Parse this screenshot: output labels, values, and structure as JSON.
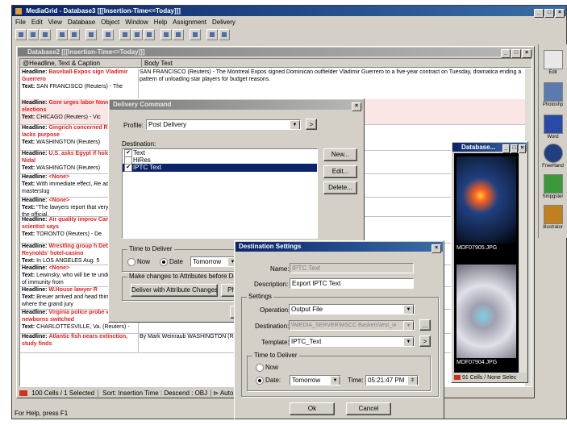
{
  "app": {
    "title": "MediaGrid - Database3 [[[Insertion-Time<=Today]]]",
    "menu": [
      "File",
      "Edit",
      "View",
      "Database",
      "Object",
      "Window",
      "Help",
      "Assignment",
      "Delivery"
    ],
    "status": "For Help, press F1"
  },
  "dock": {
    "items": [
      "Edit",
      "Photoshp",
      "Word",
      "FreeHand",
      "Smpgster",
      "Illustrator"
    ]
  },
  "db": {
    "title": "Database2 [[[Insertion-Time<=Today]]]",
    "col1": "@Headline, Text & Caption",
    "col2": "Body Text",
    "rows": [
      {
        "h": "Baseball-Expos sign Vladimir Guerrero",
        "t": "SAN FRANCISCO (Reuters) - The",
        "body": "SAN FRANCISCO (Reuters) - The Montreal Expos signed Dominican outfielder Vladimir Guerrero to a five-year contract on Tuesday, dramatica ending a pattern of unloading star players for budget reasons."
      },
      {
        "h": "Gore urges labor November elections",
        "t": "CHICAGO (Reuters) - Vic",
        "body": "S."
      },
      {
        "h": "Gingrich concerned Russia trip lacks purpose",
        "t": "WASHINGTON (Reuters)",
        "body": "ent Clinton's coming trip to Russia lacks a clear purpose and rday."
      },
      {
        "h": "U.S. asks Egypt if holding Abu Nidal",
        "t": "WASHINGTON (Reuters)",
        "body": ""
      },
      {
        "h": "<None>",
        "t": "With immediate effect, Re adopting the masterslug",
        "body": "ories about the U.S."
      },
      {
        "h": "<None>",
        "t": "\"The lawyers report that very well,\" said the official.",
        "body": ""
      },
      {
        "h": "Air quality improv Canada, scientist says",
        "t": "TORONTO (Reuters) - De",
        "body": "thern Ontario and Quebec, air q gency said Thursday."
      },
      {
        "h": "Wrestling group h Debbie Reynolds' hotel-casino",
        "t": "In LOS ANGELES Aug. 5",
        "body": ""
      },
      {
        "h": "<None>",
        "t": "Lewinsky, who will be te under a grant of immunity from",
        "body": ""
      },
      {
        "h": "W.House lawyer R",
        "t": "Breuer arrived and head third floor area where the grand jury",
        "body": ""
      },
      {
        "h": "Virginia police probe whether newborns switched",
        "t": "CHARLOTTESVILLE, Va. (Reuters) -",
        "body": "CHARLOTTESVILLE, Va."
      },
      {
        "h": "Atlantic fish nears extinction, study finds",
        "t": "",
        "body": "By Mark Weinraub WASHINGTON (Reuters) - A fish"
      }
    ],
    "headline_label": "Headline:",
    "text_label": "Text:",
    "status": {
      "cells": "100 Cells / 1 Selected",
      "sort": "Sort: Insertion Time : Descend : OBJ",
      "auto": "Auto Upda"
    }
  },
  "gallery": {
    "title": "Database...",
    "images": [
      "MDF07905.JPG",
      "MDF07904.JPG"
    ],
    "status": "91 Cells / None Selec"
  },
  "delivery": {
    "title": "Delivery Command",
    "profile_label": "Profile:",
    "profile_value": "Post Delivery",
    "destination_label": "Destination:",
    "destinations": [
      {
        "label": "Text",
        "checked": "✔"
      },
      {
        "label": "HiRes",
        "checked": ""
      },
      {
        "label": "IPTC Text",
        "checked": "✔"
      }
    ],
    "buttons": {
      "new": "New...",
      "edit": "Edit...",
      "delete": "Delete..."
    },
    "time_group": "Time to Deliver",
    "now": "Now",
    "date": "Date",
    "date_value": "Tomorrow",
    "changes_label": "Make changes to Attributes before Deliv",
    "deliver_btn": "Deliver with Attribute Changes",
    "ph_btn": "Ph",
    "ok_btn": "O"
  },
  "dest": {
    "title": "Destination Settings",
    "name_label": "Name:",
    "name_value": "IPTC Text",
    "desc_label": "Description:",
    "desc_value": "Export IPTC Text",
    "settings_group": "Settings",
    "operation_label": "Operation:",
    "operation_value": "Output File",
    "destination_label": "Destination:",
    "destination_value": "\\\\MEDIA_SERVER\\MSCC Baskets\\test_w",
    "template_label": "Template:",
    "template_value": "IPTC_Text",
    "time_group": "Time to Deliver",
    "now": "Now",
    "date": "Date:",
    "date_value": "Tomorrow",
    "time_label": "Time:",
    "time_value": "05:21:47 PM",
    "ok": "Ok",
    "cancel": "Cancel"
  }
}
